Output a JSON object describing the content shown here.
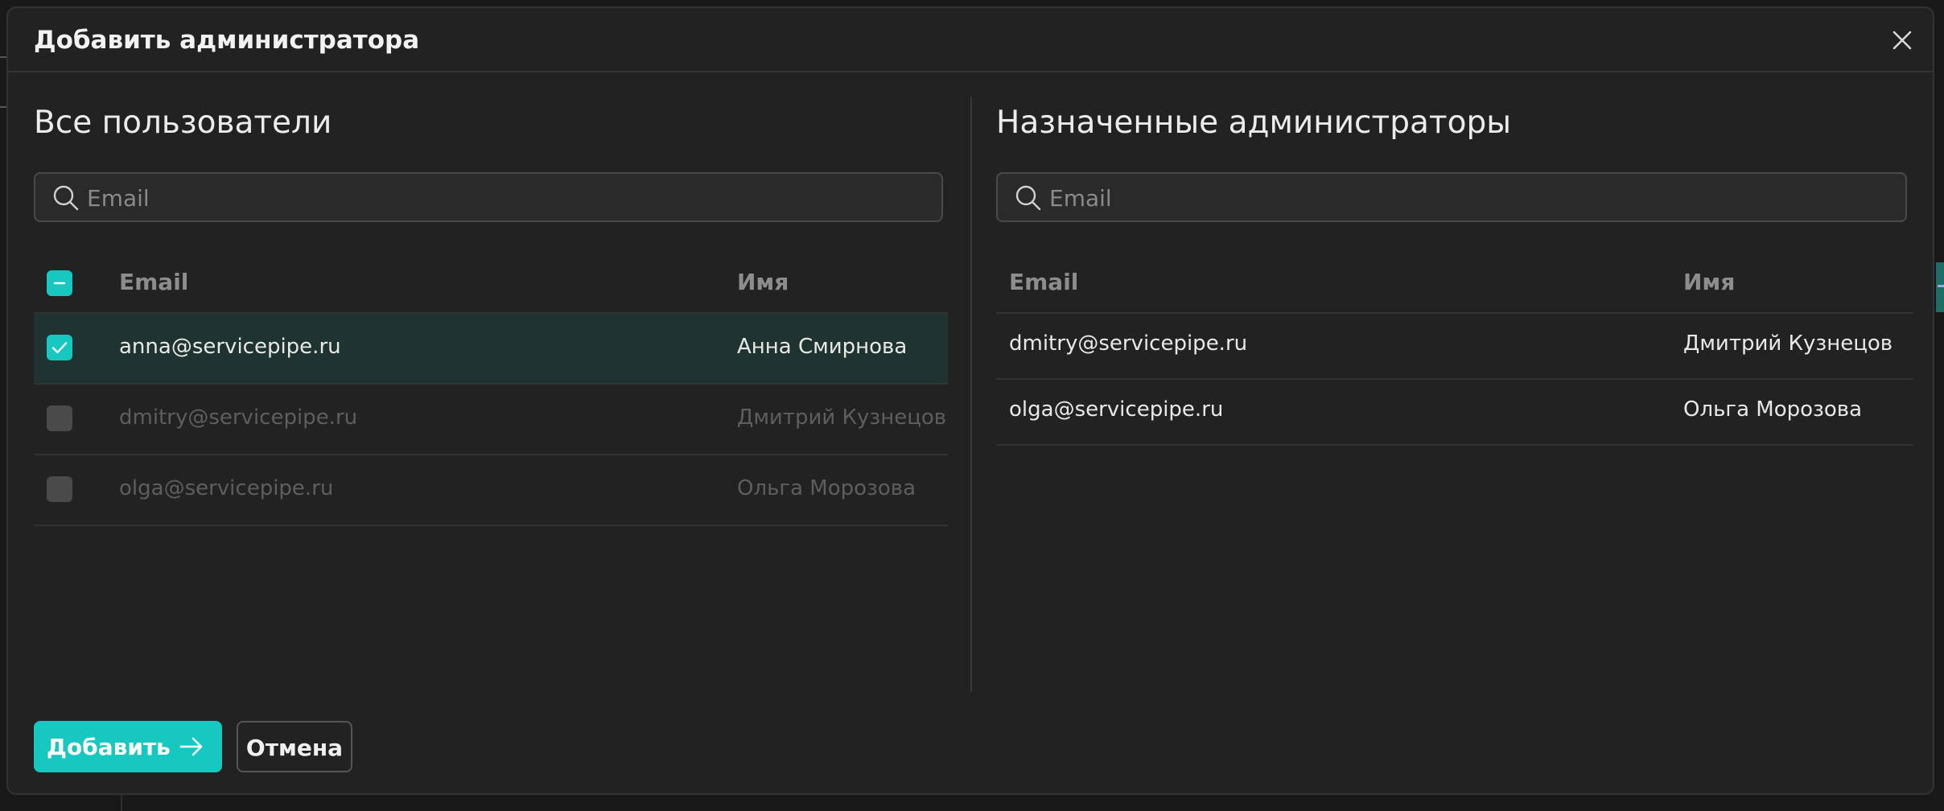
{
  "modal": {
    "title": "Добавить администратора"
  },
  "left_panel": {
    "title": "Все пользователи",
    "search_placeholder": "Email",
    "columns": {
      "email": "Email",
      "name": "Имя"
    },
    "rows": [
      {
        "email": "anna@servicepipe.ru",
        "name": "Анна Смирнова",
        "checked": true
      },
      {
        "email": "dmitry@servicepipe.ru",
        "name": "Дмитрий Кузнецов",
        "checked": false
      },
      {
        "email": "olga@servicepipe.ru",
        "name": "Ольга Морозова",
        "checked": false
      }
    ]
  },
  "right_panel": {
    "title": "Назначенные администраторы",
    "search_placeholder": "Email",
    "columns": {
      "email": "Email",
      "name": "Имя"
    },
    "rows": [
      {
        "email": "dmitry@servicepipe.ru",
        "name": "Дмитрий Кузнецов"
      },
      {
        "email": "olga@servicepipe.ru",
        "name": "Ольга Морозова"
      }
    ]
  },
  "actions": {
    "add_label": "Добавить",
    "cancel_label": "Отмена"
  },
  "colors": {
    "accent": "#16c8c0",
    "modal_bg": "#222222",
    "selected_row": "#1f3331"
  },
  "icons": [
    "close-icon",
    "search-icon",
    "check-icon",
    "minus-icon",
    "arrow-right-icon"
  ]
}
